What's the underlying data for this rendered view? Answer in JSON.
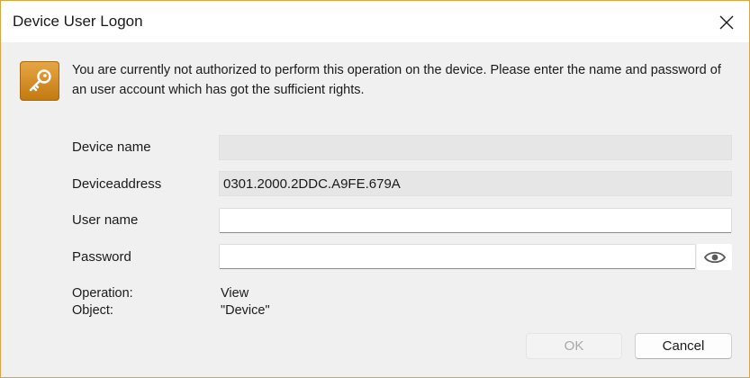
{
  "window": {
    "title": "Device User Logon"
  },
  "icons": {
    "close": "close-icon",
    "key": "key-icon",
    "eye": "eye-icon"
  },
  "colors": {
    "key_tile": "#d08f28",
    "window_border": "#d9a441",
    "dialog_background": "#f0f0f0"
  },
  "message": "You are currently not authorized to perform this operation on the device. Please enter the name and password of an user account which has got the sufficient rights.",
  "form": {
    "device_name": {
      "label": "Device name",
      "value": ""
    },
    "device_address": {
      "label": "Deviceaddress",
      "value": "0301.2000.2DDC.A9FE.679A"
    },
    "user_name": {
      "label": "User name",
      "value": ""
    },
    "password": {
      "label": "Password",
      "value": ""
    }
  },
  "info": {
    "operation_label": "Operation:",
    "operation_value": "View",
    "object_label": "Object:",
    "object_value": "\"Device\""
  },
  "buttons": {
    "ok": "OK",
    "cancel": "Cancel"
  }
}
